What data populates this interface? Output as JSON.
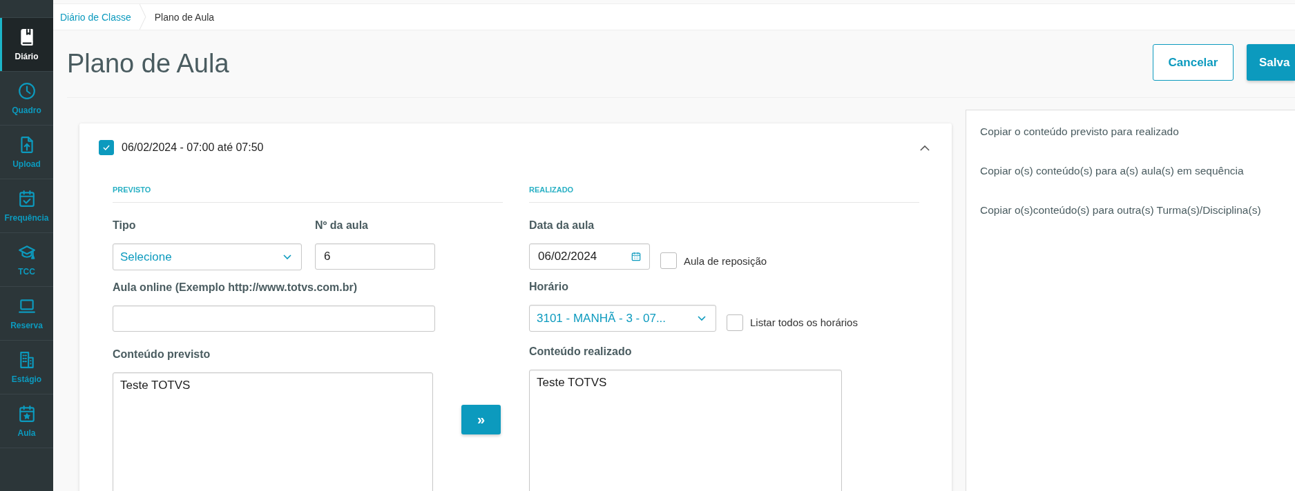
{
  "sidebar": {
    "items": [
      {
        "label": "Diário",
        "selected": true
      },
      {
        "label": "Quadro",
        "selected": false
      },
      {
        "label": "Upload",
        "selected": false
      },
      {
        "label": "Frequência",
        "selected": false
      },
      {
        "label": "TCC",
        "selected": false
      },
      {
        "label": "Reserva",
        "selected": false
      },
      {
        "label": "Estágio",
        "selected": false
      },
      {
        "label": "Aula",
        "selected": false
      }
    ]
  },
  "breadcrumb": [
    "Diário de Classe",
    "Plano de Aula"
  ],
  "page_title": "Plano de Aula",
  "actions": {
    "cancel": "Cancelar",
    "save": "Salva"
  },
  "lesson": {
    "checked": true,
    "title": "06/02/2024 - 07:00 até 07:50",
    "expanded": true,
    "previsto": {
      "heading": "PREVISTO",
      "tipo": {
        "label": "Tipo",
        "value": "Selecione"
      },
      "numero": {
        "label": "Nº da aula",
        "value": "6"
      },
      "online": {
        "label": "Aula online (Exemplo http://www.totvs.com.br)"
      },
      "conteudo": {
        "label": "Conteúdo previsto",
        "value": "Teste TOTVS"
      }
    },
    "copy_button": "»",
    "realizado": {
      "heading": "REALIZADO",
      "data": {
        "label": "Data da aula",
        "value": "06/02/2024"
      },
      "reposicao": {
        "label": "Aula de reposição",
        "checked": false
      },
      "horario": {
        "label": "Horário",
        "value": "3101 - MANHÃ - 3 - 07..."
      },
      "listar": {
        "label": "Listar todos os horários",
        "checked": false
      },
      "conteudo": {
        "label": "Conteúdo realizado",
        "value": "Teste TOTVS"
      }
    }
  },
  "copy_options": [
    "Copiar o conteúdo previsto para realizado",
    "Copiar o(s) conteúdo(s) para a(s) aula(s) em sequência",
    "Copiar o(s)conteúdo(s) para outra(s) Turma(s)/Disciplina(s)"
  ]
}
